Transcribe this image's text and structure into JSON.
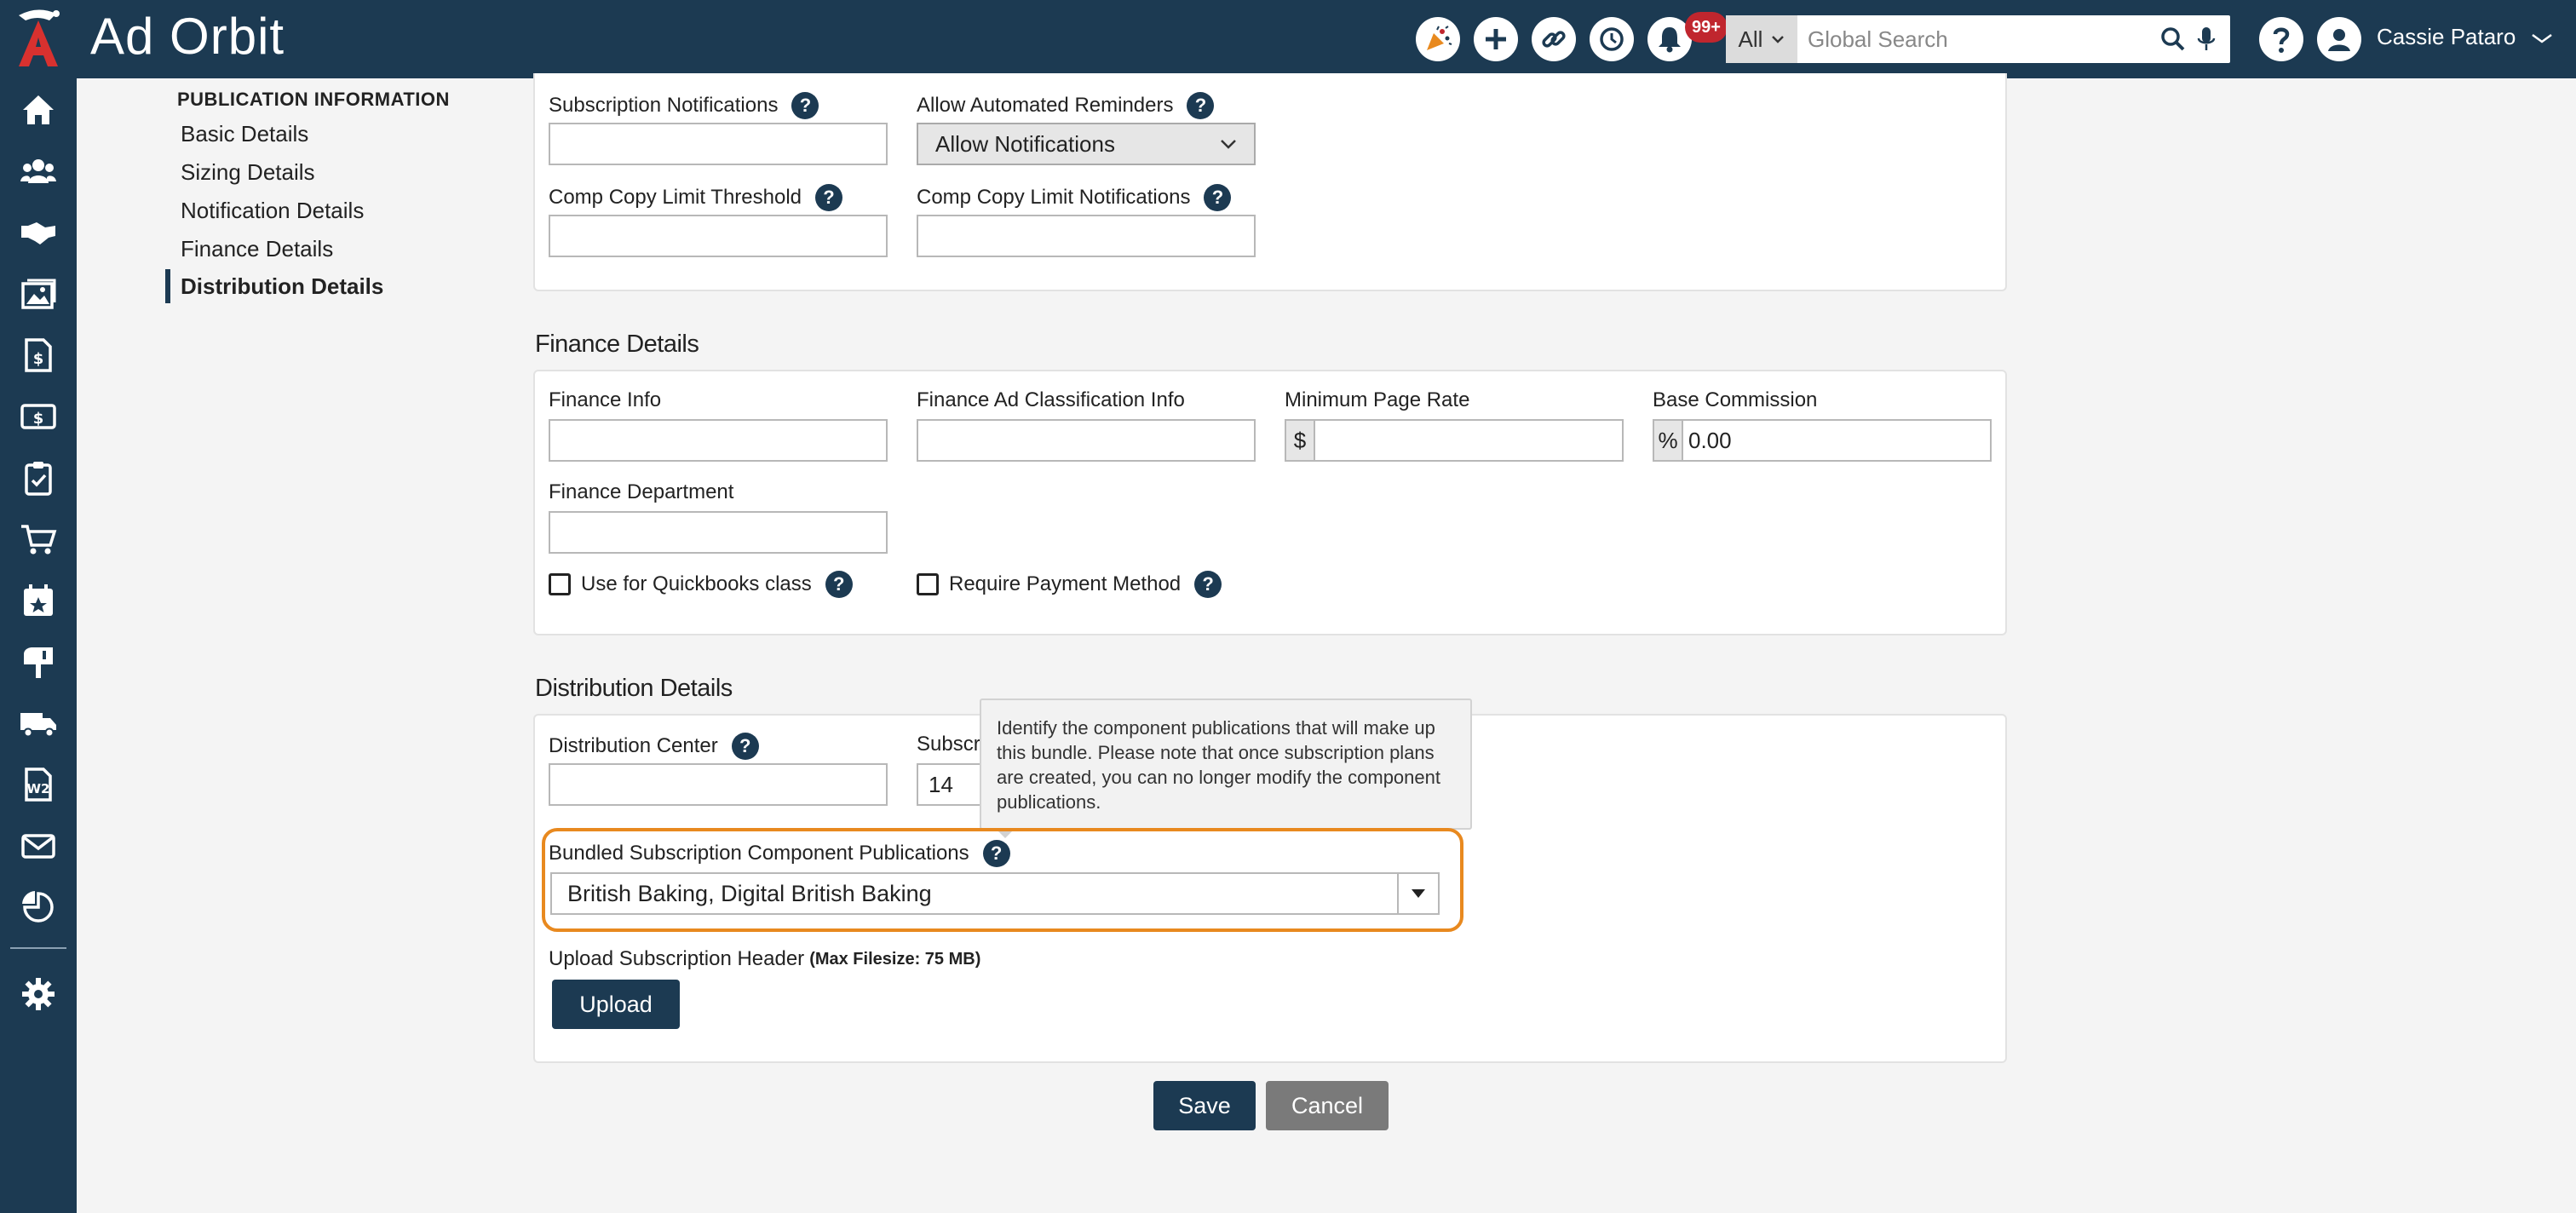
{
  "app": {
    "brand": "Ad Orbit",
    "badge_count": "99+",
    "search_scope": "All",
    "search_placeholder": "Global Search",
    "user_name": "Cassie Pataro",
    "colors": {
      "nav": "#1c3a52",
      "highlight": "#e8891f",
      "badge": "#c0262e"
    }
  },
  "topbar_icons": [
    "party-popper-icon",
    "plus-icon",
    "link-icon",
    "history-icon",
    "bell-icon",
    "help-icon",
    "user-avatar-icon"
  ],
  "sidebar_icons": [
    "home-icon",
    "contacts-icon",
    "handshake-icon",
    "images-icon",
    "invoice-icon",
    "billing-icon",
    "checklist-icon",
    "cart-icon",
    "calendar-icon",
    "mailbox-icon",
    "truck-icon",
    "w2-form-icon",
    "email-icon",
    "analytics-icon",
    "settings-icon"
  ],
  "subnav": {
    "header": "PUBLICATION INFORMATION",
    "items": [
      "Basic Details",
      "Sizing Details",
      "Notification Details",
      "Finance Details",
      "Distribution Details"
    ],
    "active": "Distribution Details"
  },
  "notification": {
    "subscription_notifications_label": "Subscription Notifications",
    "subscription_notifications_value": "",
    "allow_reminders_label": "Allow Automated Reminders",
    "allow_reminders_value": "Allow Notifications",
    "comp_threshold_label": "Comp Copy Limit Threshold",
    "comp_threshold_value": "",
    "comp_notifications_label": "Comp Copy Limit Notifications",
    "comp_notifications_value": ""
  },
  "finance": {
    "title": "Finance Details",
    "finance_info_label": "Finance Info",
    "finance_info_value": "",
    "ad_class_label": "Finance Ad Classification Info",
    "ad_class_value": "",
    "min_page_rate_label": "Minimum Page Rate",
    "min_page_rate_prefix": "$",
    "min_page_rate_value": "",
    "base_commission_label": "Base Commission",
    "base_commission_prefix": "%",
    "base_commission_value": "0.00",
    "department_label": "Finance Department",
    "department_value": "",
    "quickbooks_label": "Use for Quickbooks class",
    "quickbooks_checked": false,
    "require_payment_label": "Require Payment Method",
    "require_payment_checked": false
  },
  "distribution": {
    "title": "Distribution Details",
    "center_label": "Distribution Center",
    "center_value": "",
    "subscr_label_partial": "Subscr",
    "subscr_value": "14",
    "tooltip": "Identify the component publications that will make up this bundle. Please note that once subscription plans are created, you can no longer modify the component publications.",
    "bundled_label": "Bundled Subscription Component Publications",
    "bundled_value": "British Baking, Digital British Baking",
    "upload_label": "Upload Subscription Header",
    "upload_note": "(Max Filesize: 75 MB)",
    "upload_button": "Upload"
  },
  "actions": {
    "save": "Save",
    "cancel": "Cancel"
  }
}
